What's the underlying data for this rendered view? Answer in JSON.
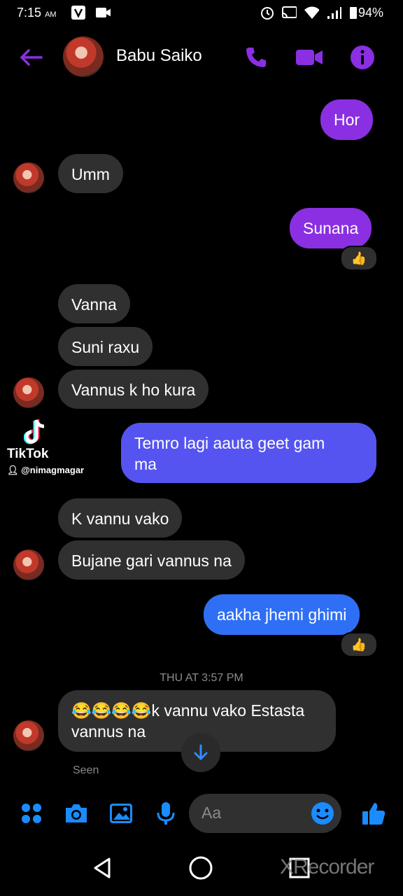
{
  "status_bar": {
    "time": "7:15",
    "ampm": "AM",
    "battery": "94%"
  },
  "header": {
    "contact_name": "Babu Saiko"
  },
  "messages": {
    "m1": "Hor",
    "m2": "Umm",
    "m3": "Sunana",
    "m3_reaction": "👍",
    "m4": "Vanna",
    "m5": "Suni raxu",
    "m6": "Vannus k ho kura",
    "m7_line1": "Temro lagi  aauta geet gam",
    "m7_line2": "ma",
    "m8": "K vannu vako",
    "m9": "Bujane gari vannus na",
    "m10": "aakha jhemi ghimi",
    "m10_reaction": "👍",
    "timestamp": "THU AT 3:57 PM",
    "m11_line1": "😂😂😂😂k vannu vako Estasta",
    "m11_line2": "vannus na",
    "seen": "Seen"
  },
  "tiktok": {
    "logo": "TikTok",
    "handle": "@nimagmagar"
  },
  "composer": {
    "placeholder": "Aa"
  },
  "watermark": "XRecorder",
  "colors": {
    "accent": "#8b2fe2",
    "bubble_in": "#303030",
    "bubble_indigo": "#5554f0",
    "bubble_blue": "#2f6ff5",
    "composer_icon": "#1a8cff"
  }
}
